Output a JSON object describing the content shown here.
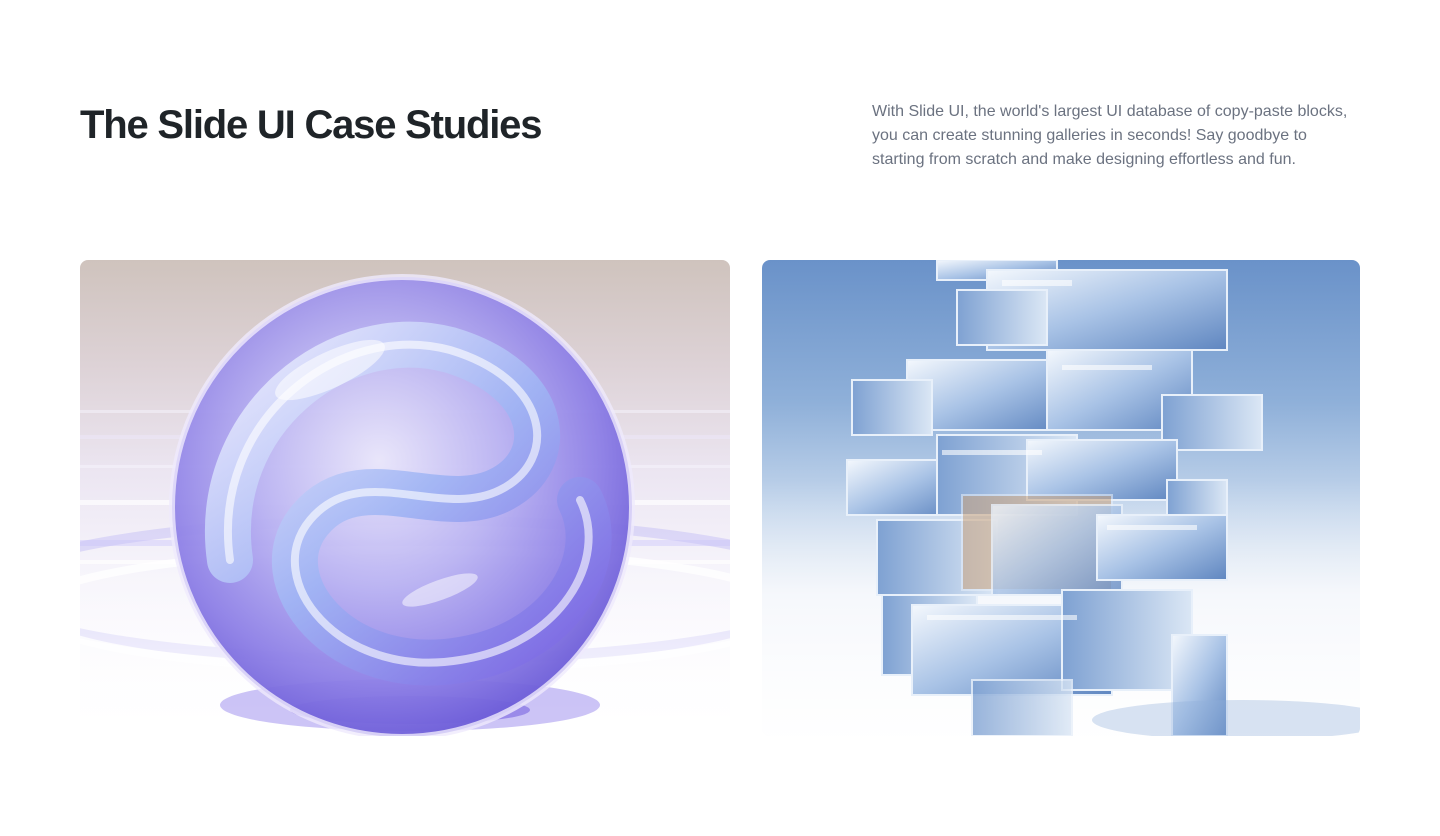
{
  "section": {
    "title": "The Slide UI Case Studies",
    "description": "With Slide UI, the world's largest UI database of copy-paste blocks, you can create stunning galleries in seconds! Say goodbye to starting from scratch and make designing effortless and fun."
  },
  "gallery": {
    "items": [
      {
        "image_subject": "glass-sphere-image",
        "palette": [
          "#cfc3bd",
          "#b8a6f0",
          "#7a6ee8",
          "#ffffff"
        ]
      },
      {
        "image_subject": "glass-cube-tower-image",
        "palette": [
          "#6a92c9",
          "#a7c3e6",
          "#ffffff",
          "#c49a6c"
        ]
      }
    ]
  }
}
